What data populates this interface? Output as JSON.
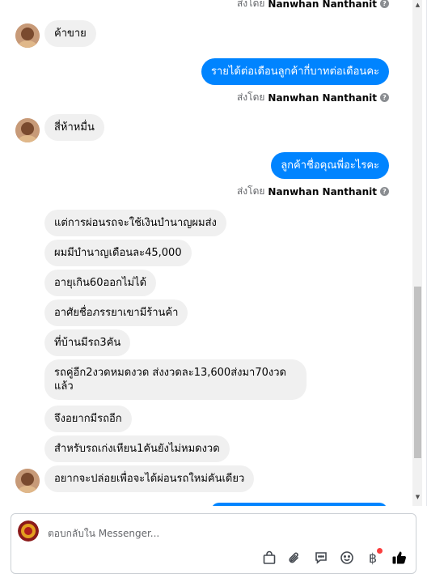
{
  "conversation": {
    "top_sent_by": {
      "prefix": "ส่งโดย",
      "name": "Nanwhan Nanthanit"
    },
    "messages_1": [
      {
        "text": "ค้าขาย"
      }
    ],
    "out_1": {
      "text": "รายได้ต่อเดือนลูกค้ากี่บาทต่อเดือนคะ"
    },
    "sent_by_1": {
      "prefix": "ส่งโดย",
      "name": "Nanwhan Nanthanit"
    },
    "messages_2": [
      {
        "text": "สี่ห้าหมื่น"
      }
    ],
    "out_2": {
      "text": "ลูกค้าชื่อคุณพี่อะไรคะ"
    },
    "sent_by_2": {
      "prefix": "ส่งโดย",
      "name": "Nanwhan Nanthanit"
    },
    "messages_3": [
      {
        "text": "แต่การผ่อนรถจะใช้เงินบำนาญผมส่ง"
      },
      {
        "text": "ผมมีบำนาญเดือนละ45,000"
      },
      {
        "text": "อายุเกิน60ออกไม่ได้"
      },
      {
        "text": "อาศัยชื่อภรรยาเขามีร้านค้า"
      },
      {
        "text": "ที่บ้านมีรถ3คัน"
      },
      {
        "text": "รถคู่อีก2งวดหมดงวด ส่งงวดละ13,600ส่งมา70งวดแล้ว"
      },
      {
        "text": "จึงอยากมีรถอีก"
      },
      {
        "text": "สำหรับรถเก่งเหียน1คันยังไม่หมดงวด"
      },
      {
        "text": "อยากจะปล่อยเพื่อจะได้ผ่อนรถใหม่คันเดียว"
      }
    ]
  },
  "composer": {
    "placeholder": "ตอบกลับใน Messenger...",
    "icons": [
      "bag-icon",
      "paperclip-icon",
      "quick-reply-icon",
      "emoji-icon",
      "baht-payment-icon",
      "thumbs-up-icon"
    ]
  },
  "colors": {
    "outgoing_bubble": "#0084ff",
    "incoming_bubble": "#f0f0f0",
    "like_button": "#050505"
  }
}
